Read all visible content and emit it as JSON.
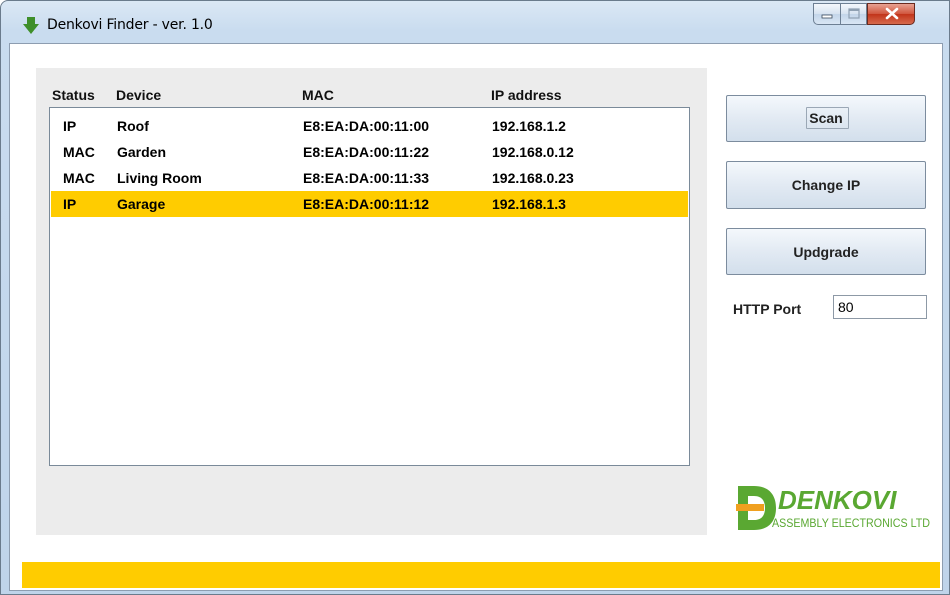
{
  "window": {
    "title": "Denkovi Finder - ver. 1.0",
    "icon": "green-down-arrow-icon",
    "controls": [
      "minimize-icon",
      "maximize-icon",
      "close-icon"
    ]
  },
  "device_list": {
    "columns": [
      "Status",
      "Device",
      "MAC",
      "IP address"
    ],
    "rows": [
      {
        "status": "IP",
        "device": "Roof",
        "mac": "E8:EA:DA:00:11:00",
        "ip": "192.168.1.2",
        "selected": false
      },
      {
        "status": "MAC",
        "device": "Garden",
        "mac": "E8:EA:DA:00:11:22",
        "ip": "192.168.0.12",
        "selected": false
      },
      {
        "status": "MAC",
        "device": "Living Room",
        "mac": "E8:EA:DA:00:11:33",
        "ip": "192.168.0.23",
        "selected": false
      },
      {
        "status": "IP",
        "device": "Garage",
        "mac": "E8:EA:DA:00:11:12",
        "ip": "192.168.1.3",
        "selected": true
      }
    ]
  },
  "actions": {
    "scan_label": "Scan",
    "change_ip_label": "Change IP",
    "upgrade_label": "Updgrade"
  },
  "http_port": {
    "label": "HTTP Port",
    "value": "80"
  },
  "logo": {
    "name": "DENKOVI",
    "tagline": "ASSEMBLY ELECTRONICS LTD"
  },
  "colors": {
    "selection": "#ffcc00",
    "status_bar": "#ffcc00",
    "logo_green": "#5aa832"
  }
}
